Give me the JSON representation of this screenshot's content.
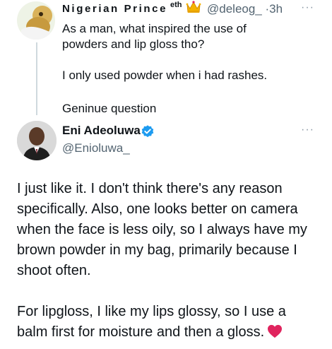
{
  "reply_to_tweet": {
    "author_name": "Nigerian Prince",
    "name_suffix": "eth",
    "name_dot": ".",
    "handle": "@deleog_",
    "separator": "·",
    "time": "3h",
    "more": "···",
    "lines": [
      "As a man, what inspired the use of",
      "powders and lip gloss tho?",
      "",
      "I only used powder when i had rashes.",
      "",
      "Geninue question"
    ]
  },
  "main_tweet": {
    "author_name": "Eni Adeoluwa",
    "handle": "@Enioluwa_",
    "more": "···",
    "paragraph1": [
      "I just like it. I don't think there's any reason",
      "specifically. Also, one looks better on camera",
      "when the face is less oily, so I always have my",
      "brown powder in my bag, primarily because I",
      "shoot often."
    ],
    "paragraph2": [
      "For lipgloss, I like my lips glossy, so I use a",
      "balm first for moisture and then a gloss."
    ]
  },
  "colors": {
    "text": "#0f1419",
    "secondary": "#536471",
    "verified": "#1d9bf0",
    "heart": "#e0245e",
    "thread_line": "#cfd9de"
  },
  "icons": [
    "crown-icon",
    "verified-badge-icon",
    "red-heart-icon",
    "more-options-icon"
  ]
}
